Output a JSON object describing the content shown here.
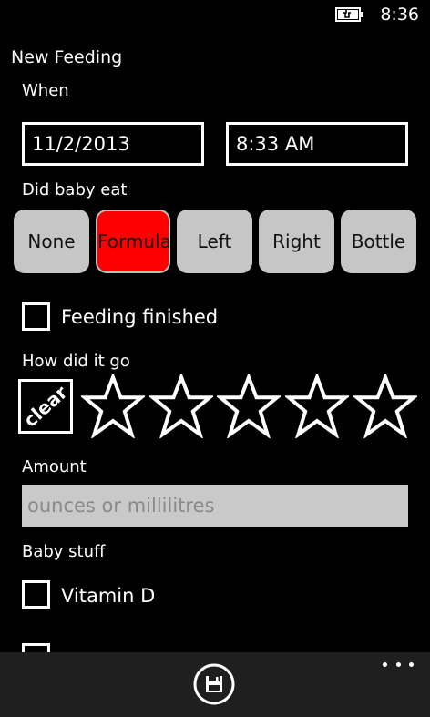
{
  "status_bar": {
    "time": "8:36",
    "battery_icon": "battery-charging-icon"
  },
  "page": {
    "title": "New Feeding"
  },
  "when": {
    "label": "When",
    "date": "11/2/2013",
    "time": "8:33 AM"
  },
  "did_eat": {
    "label": "Did baby eat",
    "options": [
      "None",
      "Formula",
      "Left",
      "Right",
      "Bottle"
    ],
    "selected": "Formula",
    "selected_color": "#ff0000"
  },
  "feeding_finished": {
    "label": "Feeding finished",
    "checked": false
  },
  "rating": {
    "label": "How did it go",
    "clear_label": "clear",
    "stars_total": 5,
    "stars_value": 0
  },
  "amount": {
    "label": "Amount",
    "value": "",
    "placeholder": "ounces or millilitres"
  },
  "baby_stuff": {
    "label": "Baby stuff",
    "items": [
      {
        "label": "Vitamin D",
        "checked": false
      }
    ]
  },
  "app_bar": {
    "save_icon": "save-icon",
    "more_icon": "more-icon"
  }
}
